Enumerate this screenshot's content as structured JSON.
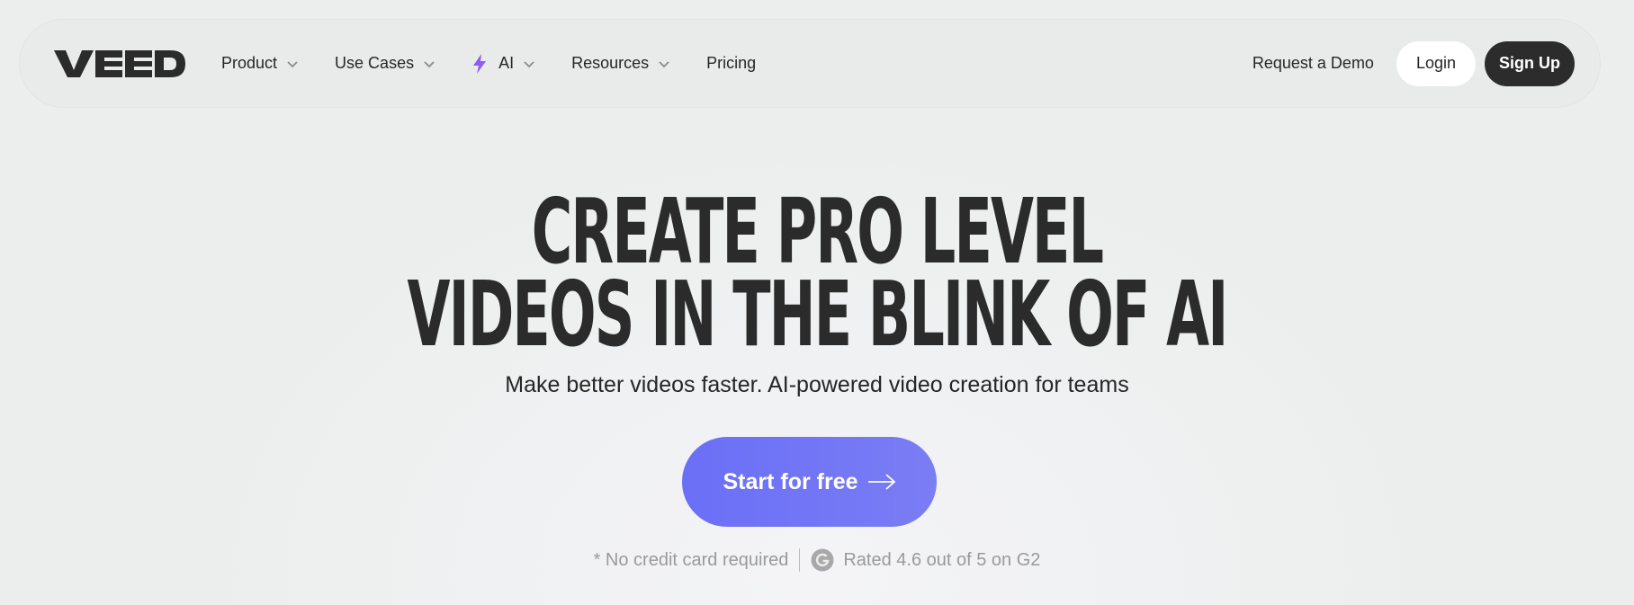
{
  "brand": {
    "logo_text": "VEED"
  },
  "nav": {
    "items": [
      {
        "label": "Product",
        "has_dropdown": true
      },
      {
        "label": "Use Cases",
        "has_dropdown": true
      },
      {
        "label": "AI",
        "has_dropdown": true,
        "icon": "sparkle-icon"
      },
      {
        "label": "Resources",
        "has_dropdown": true
      },
      {
        "label": "Pricing",
        "has_dropdown": false
      }
    ],
    "demo_label": "Request a Demo",
    "login_label": "Login",
    "signup_label": "Sign Up"
  },
  "hero": {
    "title_line1": "CREATE PRO LEVEL",
    "title_line2": "VIDEOS IN THE BLINK OF AI",
    "subtitle": "Make better videos faster. AI-powered video creation for teams",
    "cta_label": "Start for free",
    "no_card_text": "* No credit card required",
    "rating_text": "Rated 4.6 out of 5 on G2"
  },
  "colors": {
    "background": "#eceeed",
    "cta_start": "#6a6ff7",
    "cta_end": "#7a7df4",
    "signup_bg": "#2c2c2c",
    "ai_sparkle": "#8b5cf6"
  }
}
